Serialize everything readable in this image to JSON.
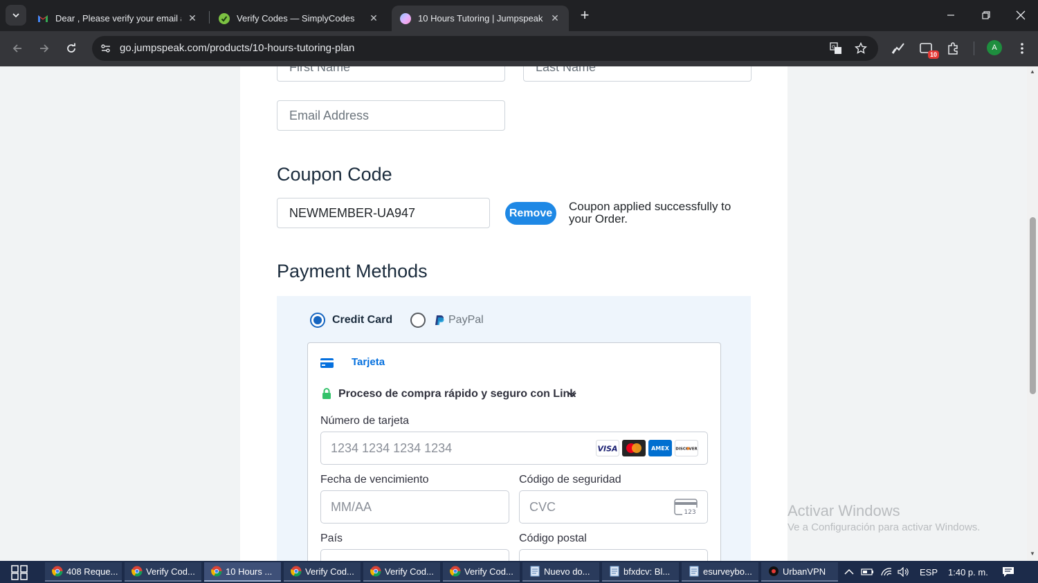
{
  "browser": {
    "tabs": [
      {
        "title": "Dear , Please verify your email a",
        "icon": "gmail-icon",
        "active": false
      },
      {
        "title": "Verify Codes — SimplyCodes",
        "icon": "simplycodes-icon",
        "active": false
      },
      {
        "title": "10 Hours Tutoring | Jumpspeak",
        "icon": "jumpspeak-icon",
        "active": true
      }
    ],
    "url": "go.jumpspeak.com/products/10-hours-tutoring-plan",
    "extension_badge": "10",
    "profile_initial": "A"
  },
  "form": {
    "first_name_placeholder": "First Name",
    "last_name_placeholder": "Last Name",
    "email_placeholder": "Email Address"
  },
  "coupon": {
    "heading": "Coupon Code",
    "code": "NEWMEMBER-UA947",
    "remove_label": "Remove",
    "message": "Coupon applied successfully to your Order."
  },
  "payment": {
    "heading": "Payment Methods",
    "option_credit_card": "Credit Card",
    "option_paypal": "PayPal",
    "selected": "Credit Card",
    "card_tab_label": "Tarjeta",
    "link_prompt": "Proceso de compra rápido y seguro con Link",
    "card_number_label": "Número de tarjeta",
    "card_number_placeholder": "1234 1234 1234 1234",
    "card_brands": [
      "VISA",
      "Mastercard",
      "AMEX",
      "DISCOVER"
    ],
    "expiry_label": "Fecha de vencimiento",
    "expiry_placeholder": "MM/AA",
    "cvc_label": "Código de seguridad",
    "cvc_placeholder": "CVC",
    "cvc_icon_text": "123",
    "country_label": "País",
    "postal_label": "Código postal"
  },
  "watermark": {
    "title": "Activar Windows",
    "subtitle": "Ve a Configuración para activar Windows."
  },
  "taskbar": {
    "items": [
      {
        "label": "408 Reque...",
        "icon": "chrome-icon"
      },
      {
        "label": "Verify Cod...",
        "icon": "chrome-icon"
      },
      {
        "label": "10 Hours ...",
        "icon": "chrome-icon"
      },
      {
        "label": "Verify Cod...",
        "icon": "chrome-icon"
      },
      {
        "label": "Verify Cod...",
        "icon": "chrome-icon"
      },
      {
        "label": "Verify Cod...",
        "icon": "chrome-icon"
      },
      {
        "label": "Nuevo do...",
        "icon": "notepad-icon"
      },
      {
        "label": "bfxdcv: Bl...",
        "icon": "notepad-icon"
      },
      {
        "label": "esurveybo...",
        "icon": "notepad-icon"
      },
      {
        "label": "UrbanVPN",
        "icon": "urbanvpn-icon"
      }
    ],
    "language": "ESP",
    "time": "1:40 p. m."
  },
  "colors": {
    "accent": "#1e88e5",
    "heading": "#1a2b3c",
    "payment_bg": "#eef5fc"
  }
}
